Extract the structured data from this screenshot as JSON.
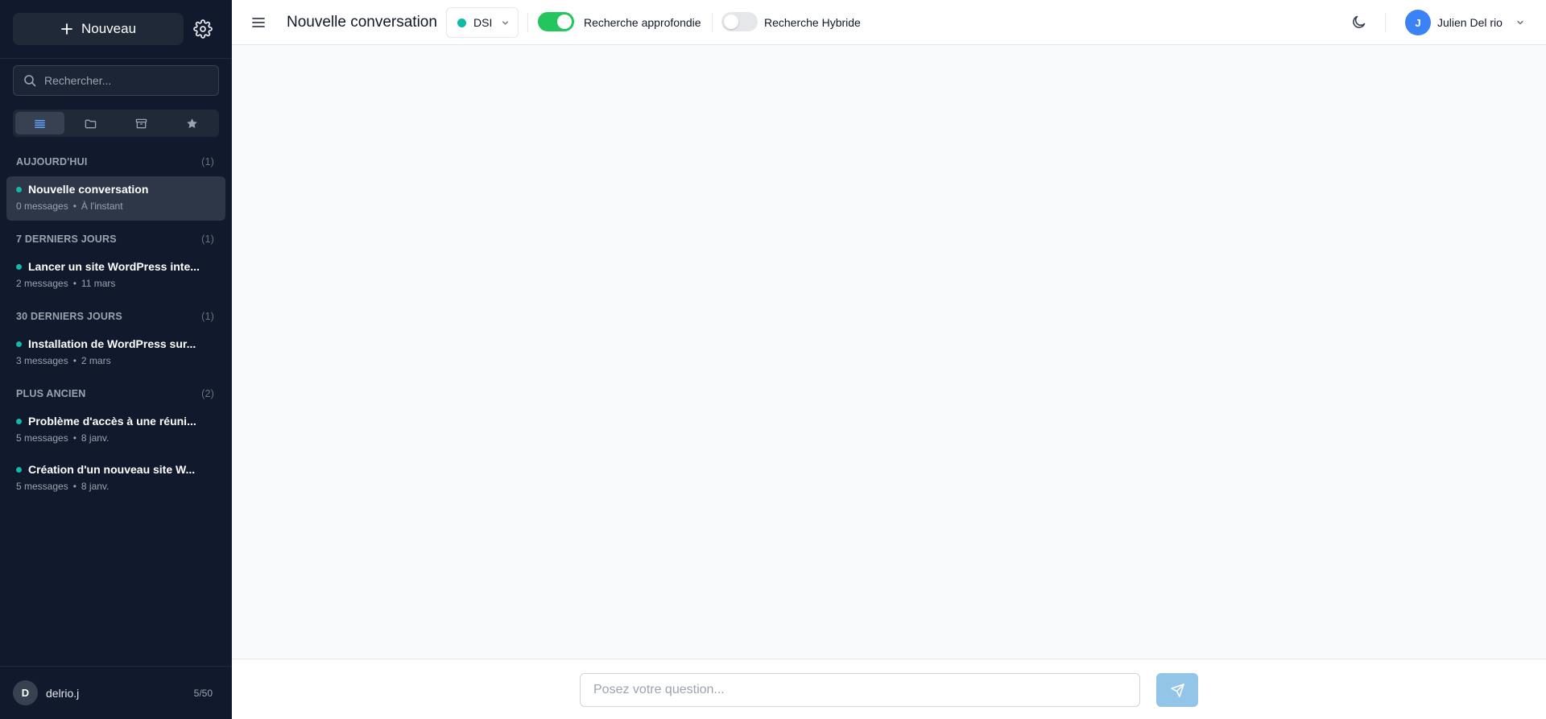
{
  "sidebar": {
    "new_button": "Nouveau",
    "search_placeholder": "Rechercher...",
    "groups": [
      {
        "label": "AUJOURD'HUI",
        "count": "(1)"
      },
      {
        "label": "7 DERNIERS JOURS",
        "count": "(1)"
      },
      {
        "label": "30 DERNIERS JOURS",
        "count": "(1)"
      },
      {
        "label": "PLUS ANCIEN",
        "count": "(2)"
      }
    ],
    "conversations": [
      {
        "title": "Nouvelle conversation",
        "messages": "0 messages",
        "time": "À l'instant"
      },
      {
        "title": "Lancer un site WordPress inte...",
        "messages": "2 messages",
        "time": "11 mars"
      },
      {
        "title": "Installation de WordPress sur...",
        "messages": "3 messages",
        "time": "2 mars"
      },
      {
        "title": "Problème d'accès à une réuni...",
        "messages": "5 messages",
        "time": "8 janv."
      },
      {
        "title": "Création d'un nouveau site W...",
        "messages": "5 messages",
        "time": "8 janv."
      }
    ],
    "footer": {
      "avatar_initial": "D",
      "username": "delrio.j",
      "quota": "5/50"
    }
  },
  "header": {
    "title": "Nouvelle conversation",
    "department": "DSI",
    "deep_search_label": "Recherche approfondie",
    "hybrid_search_label": "Recherche Hybride",
    "user_initial": "J",
    "user_name": "Julien Del rio"
  },
  "composer": {
    "placeholder": "Posez votre question..."
  },
  "colors": {
    "accent": "#14b8a6",
    "toggle_on": "#22c55e",
    "sidebar_bg": "#111a2c",
    "avatar": "#3b82f6"
  }
}
